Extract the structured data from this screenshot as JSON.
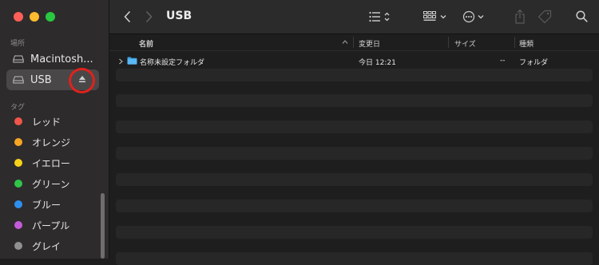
{
  "window": {
    "title": "USB"
  },
  "sidebar": {
    "locations_label": "場所",
    "locations": [
      {
        "label": "Macintosh...",
        "icon": "internal-drive-icon"
      },
      {
        "label": "USB",
        "icon": "external-drive-icon",
        "selected": true,
        "eject_icon": "eject-icon"
      }
    ],
    "tags_label": "タグ",
    "tags": [
      {
        "label": "レッド",
        "color": "#f0554a"
      },
      {
        "label": "オレンジ",
        "color": "#f6a623"
      },
      {
        "label": "イエロー",
        "color": "#f7d21a"
      },
      {
        "label": "グリーン",
        "color": "#30c548"
      },
      {
        "label": "ブルー",
        "color": "#2e8ff0"
      },
      {
        "label": "パープル",
        "color": "#c35bd8"
      },
      {
        "label": "グレイ",
        "color": "#909090"
      }
    ]
  },
  "toolbar": {
    "icons": [
      "back-icon",
      "forward-icon",
      "list-view-icon",
      "group-icon",
      "more-actions-icon",
      "share-icon",
      "tag-icon",
      "search-icon"
    ]
  },
  "columns": {
    "name": "名前",
    "date_modified": "変更日",
    "size": "サイズ",
    "kind": "種類"
  },
  "files": [
    {
      "name": "名称未設定フォルダ",
      "date_modified": "今日 12:21",
      "size": "--",
      "kind": "フォルダ",
      "icon": "folder-icon"
    }
  ]
}
